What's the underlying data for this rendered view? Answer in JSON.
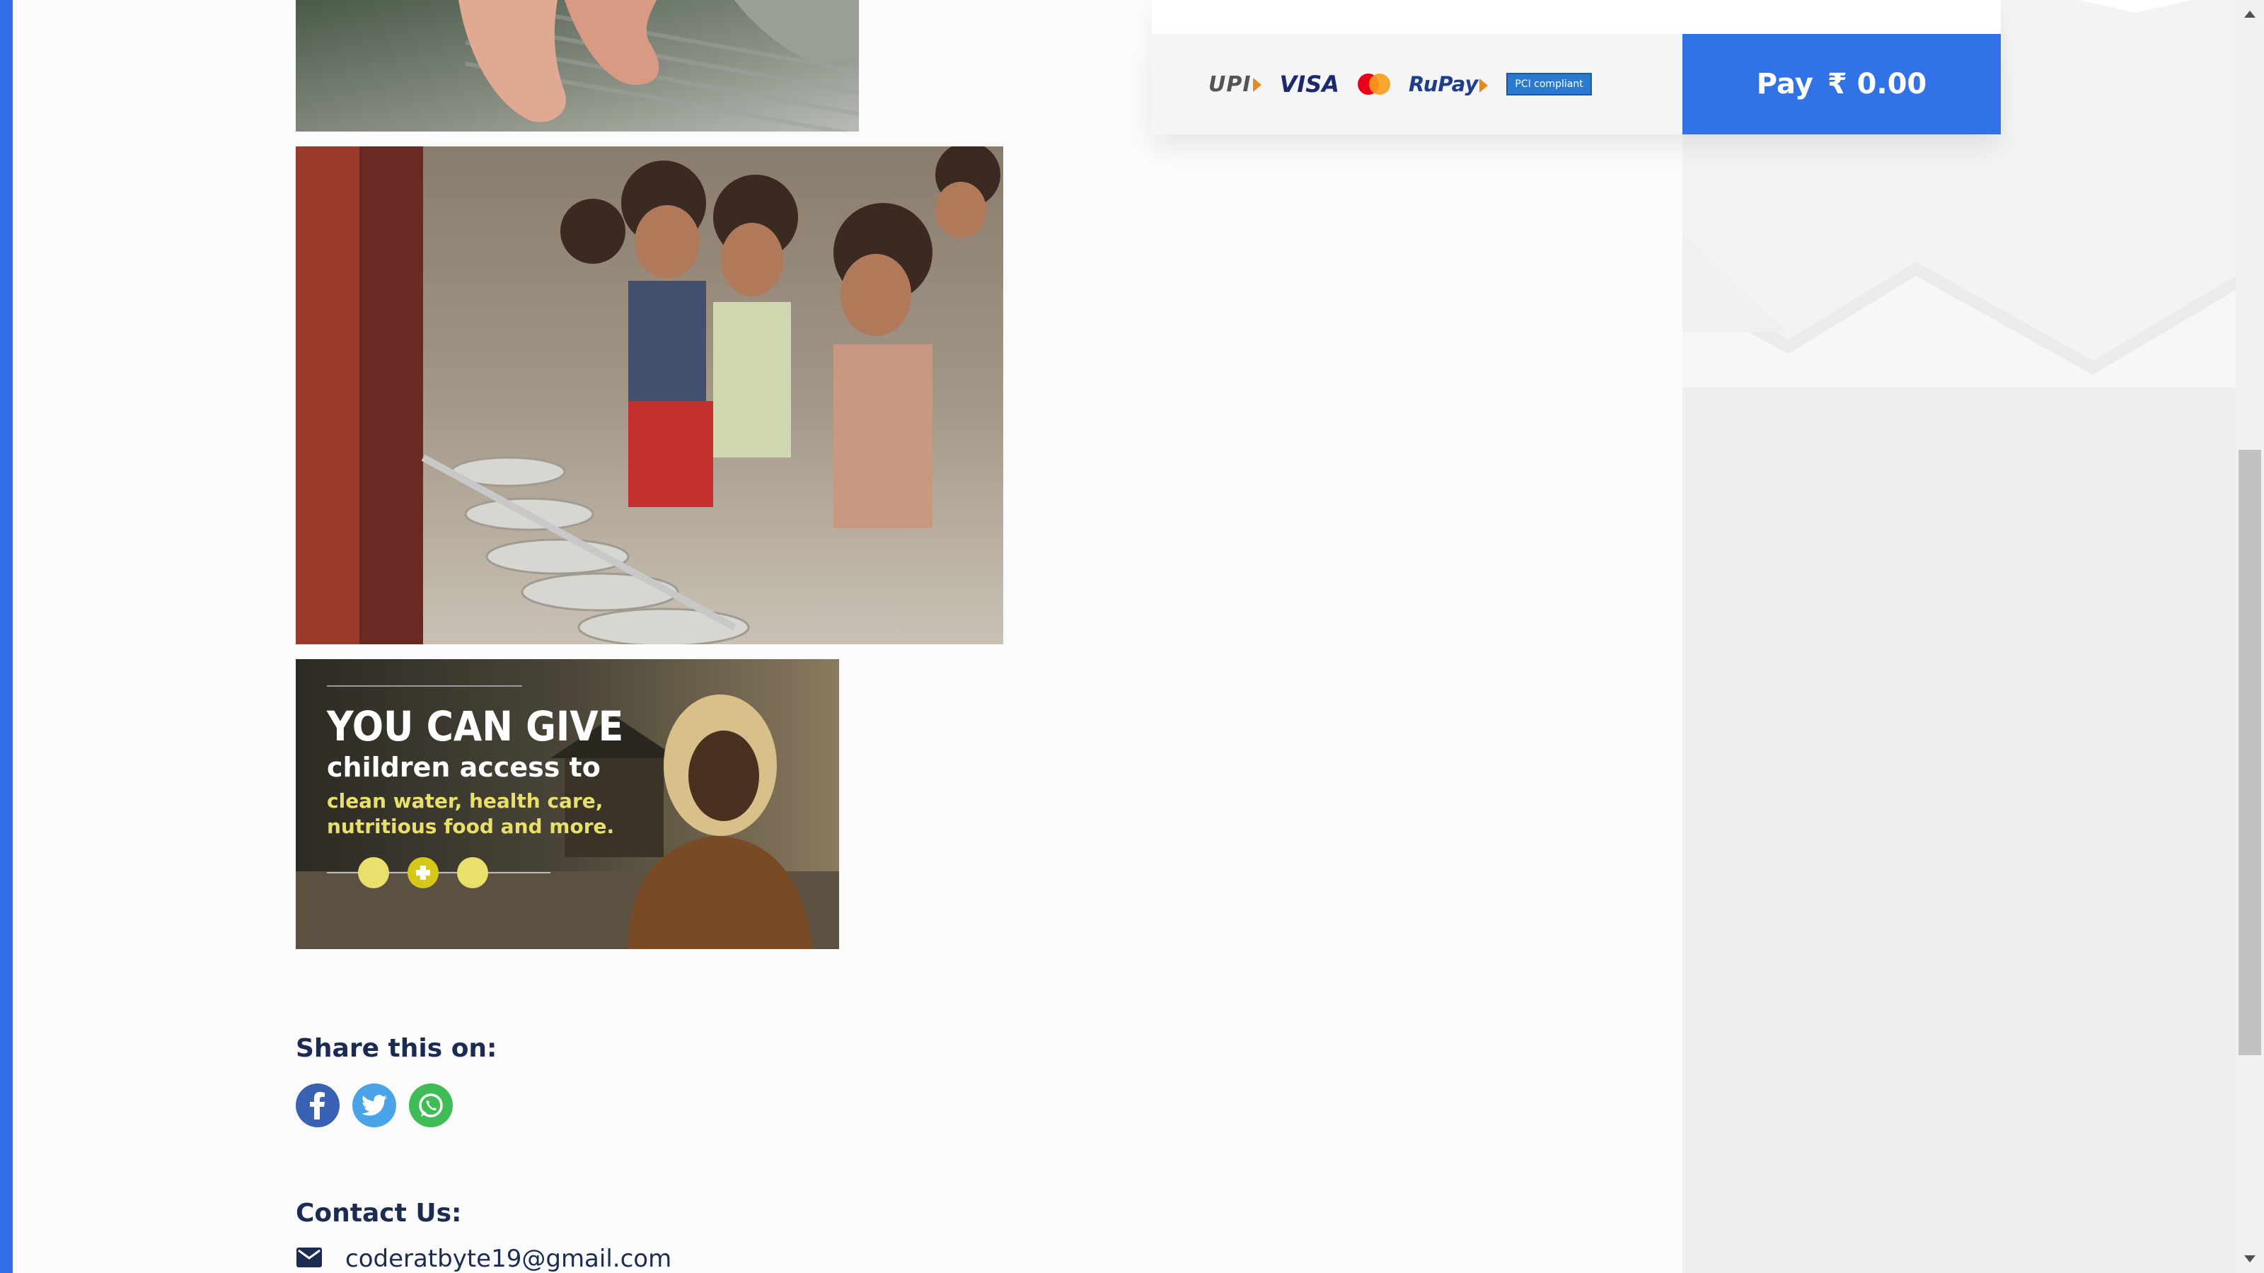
{
  "payment": {
    "methods": {
      "upi": "UPI",
      "visa": "VISA",
      "mastercard_icon": "mastercard-icon",
      "rupay": "RuPay",
      "pci": "PCI compliant"
    },
    "pay_label": "Pay",
    "amount": "₹ 0.00"
  },
  "gallery": {
    "images": [
      {
        "name": "hands-photo",
        "description_icon": "photo"
      },
      {
        "name": "children-eating-photo",
        "description_icon": "photo"
      },
      {
        "name": "donation-banner-image",
        "description_icon": "photo"
      }
    ],
    "banner_text": {
      "line1": "YOU CAN GIVE",
      "line2": "children access to",
      "line3": "clean water, health care,",
      "line4": "nutritious food and more."
    }
  },
  "share": {
    "label": "Share this on:",
    "icons": [
      "facebook-icon",
      "twitter-icon",
      "whatsapp-icon"
    ]
  },
  "contact": {
    "label": "Contact Us:",
    "email": "coderatbyte19@gmail.com"
  },
  "colors": {
    "accent": "#2f6ee8",
    "pay_button": "#3173e6",
    "text": "#1b2b52",
    "facebook": "#3a62b4",
    "twitter": "#4aa3e6",
    "whatsapp": "#3fbc56"
  }
}
